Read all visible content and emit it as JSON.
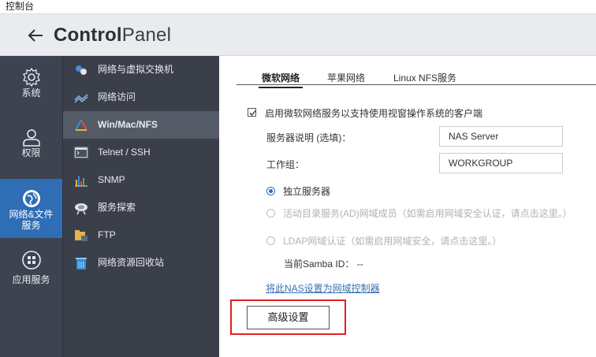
{
  "window": {
    "title": "控制台"
  },
  "header": {
    "title_bold": "Control",
    "title_light": "Panel"
  },
  "leftnav": {
    "items": [
      {
        "label": "系统",
        "icon": "gear-icon"
      },
      {
        "label": "权限",
        "icon": "user-icon"
      },
      {
        "label_line1": "网络&文件",
        "label_line2": "服务",
        "icon": "network-globe-icon"
      },
      {
        "label": "应用服务",
        "icon": "apps-grid-icon"
      }
    ]
  },
  "subnav": {
    "items": [
      {
        "label": "网络与虚拟交换机",
        "icon": "network-switch-icon"
      },
      {
        "label": "网络访问",
        "icon": "network-access-icon"
      },
      {
        "label": "Win/Mac/NFS",
        "icon": "win-mac-nfs-icon"
      },
      {
        "label": "Telnet / SSH",
        "icon": "terminal-icon"
      },
      {
        "label": "SNMP",
        "icon": "bar-chart-icon"
      },
      {
        "label": "服务探索",
        "icon": "service-discovery-icon"
      },
      {
        "label": "FTP",
        "icon": "ftp-folder-icon"
      },
      {
        "label": "网络资源回收站",
        "icon": "recycle-bin-icon"
      }
    ]
  },
  "tabs": [
    "微软网络",
    "苹果网络",
    "Linux NFS服务"
  ],
  "form": {
    "enable_label": "启用微软网络服务以支持使用视窗操作系统的客户端",
    "server_desc_label": "服务器说明 (选填)：",
    "server_desc_value": "NAS Server",
    "workgroup_label": "工作组：",
    "workgroup_value": "WORKGROUP",
    "radio_standalone": "独立服务器",
    "radio_ad": "活动目录服务(AD)网域成员（如需启用网域安全认证，请点击这里。）",
    "radio_ldap": "LDAP网域认证（如需启用网域安全，请点击这里。）",
    "samba_id_label": "当前Samba ID：",
    "samba_id_value": "--",
    "dc_link": "将此NAS设置为网域控制器",
    "advanced_button": "高级设置"
  },
  "colors": {
    "accent": "#2f6db5",
    "highlight": "#e02020",
    "nav_bg": "#3d4350"
  }
}
